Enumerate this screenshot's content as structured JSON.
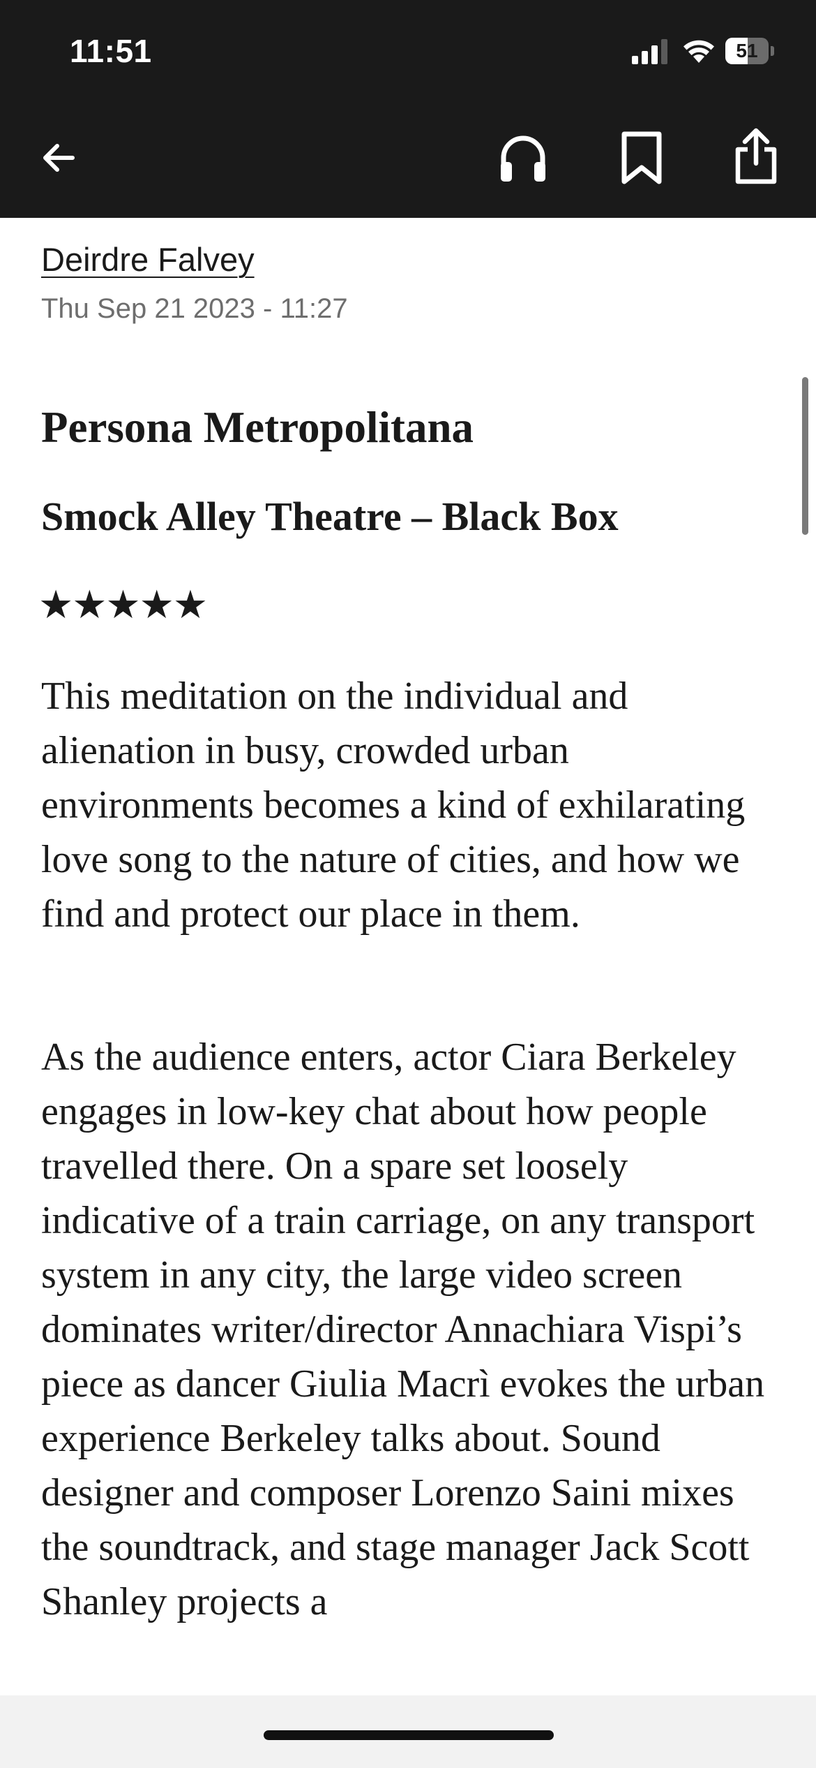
{
  "status_bar": {
    "time": "11:51",
    "battery_level": "51",
    "battery_percent": 51,
    "signal_icon": "cellular-signal-icon",
    "wifi_icon": "wifi-icon"
  },
  "toolbar": {
    "back_icon": "arrow-left-icon",
    "audio_icon": "headphones-icon",
    "bookmark_icon": "bookmark-icon",
    "share_icon": "share-icon"
  },
  "article": {
    "author": "Deirdre Falvey",
    "date": "Thu Sep 21 2023 - 11:27",
    "title": "Persona Metropolitana",
    "venue": "Smock Alley Theatre – Black Box",
    "rating": "★★★★★",
    "rating_value": 5,
    "rating_max": 5,
    "paragraphs": [
      "This meditation on the individual and alienation in busy, crowded urban environments becomes a kind of exhilarating love song to the nature of cities, and how we find and protect our place in them.",
      "As the audience enters, actor Ciara Berkeley engages in low-key chat about how people travelled there. On a spare set loosely indicative of a train carriage, on any transport system in any city, the large video screen dominates writer/director Annachiara Vispi’s piece as dancer Giulia Macrì evokes the urban experience Berkeley talks about. Sound designer and composer Lorenzo Saini mixes the soundtrack, and stage manager Jack Scott Shanley projects a"
    ]
  },
  "colors": {
    "header_background": "#1a1a1a",
    "text": "#1a1a1a",
    "date_text": "#6e6e6e",
    "bottom_bar": "#f2f2f2"
  }
}
